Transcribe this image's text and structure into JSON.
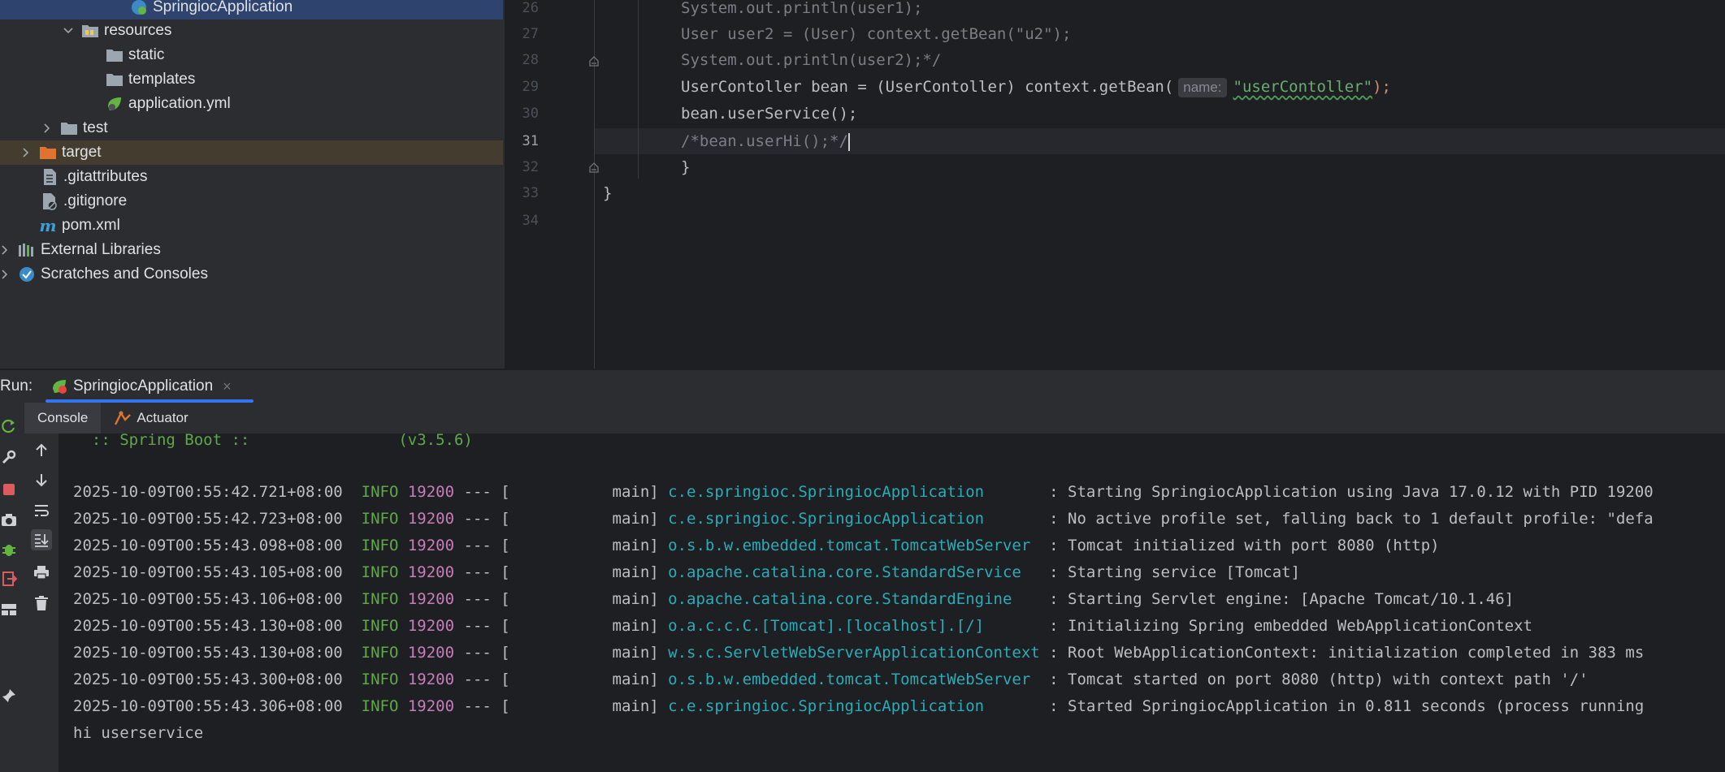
{
  "project_tree": {
    "items": [
      {
        "label": "SpringiocApplication",
        "icon": "spring-boot-class-icon",
        "expandable": false,
        "expanded": false
      },
      {
        "label": "resources",
        "icon": "resources-folder-icon",
        "expandable": true,
        "expanded": true
      },
      {
        "label": "static",
        "icon": "folder-icon",
        "expandable": false,
        "expanded": false
      },
      {
        "label": "templates",
        "icon": "folder-icon",
        "expandable": false,
        "expanded": false
      },
      {
        "label": "application.yml",
        "icon": "spring-config-icon",
        "expandable": false,
        "expanded": false
      },
      {
        "label": "test",
        "icon": "folder-icon",
        "expandable": true,
        "expanded": false
      },
      {
        "label": "target",
        "icon": "excluded-folder-icon",
        "expandable": true,
        "expanded": false
      },
      {
        "label": ".gitattributes",
        "icon": "file-icon",
        "expandable": false,
        "expanded": false
      },
      {
        "label": ".gitignore",
        "icon": "ignored-file-icon",
        "expandable": false,
        "expanded": false
      },
      {
        "label": "pom.xml",
        "icon": "maven-icon",
        "expandable": false,
        "expanded": false
      },
      {
        "label": "External Libraries",
        "icon": "libraries-icon",
        "expandable": true,
        "expanded": false
      },
      {
        "label": "Scratches and Consoles",
        "icon": "scratches-icon",
        "expandable": true,
        "expanded": false
      }
    ]
  },
  "editor": {
    "current_line": "31",
    "lines": [
      {
        "number": "26",
        "text": "System.out.println(user1);"
      },
      {
        "number": "27",
        "text": "User user2 = (User) context.getBean(\"u2\");"
      },
      {
        "number": "28",
        "text": "System.out.println(user2);*/"
      },
      {
        "number": "29",
        "text_before": "UserContoller bean = (UserContoller) context.getBean(",
        "hint": "name:",
        "string": "\"userContoller\"",
        "text_after": ");"
      },
      {
        "number": "30",
        "text": "bean.userService();"
      },
      {
        "number": "31",
        "text": "/*bean.userHi();*/"
      },
      {
        "number": "32",
        "text": "}"
      },
      {
        "number": "33",
        "text": "}"
      },
      {
        "number": "34",
        "text": ""
      }
    ]
  },
  "run_panel": {
    "label": "Run:",
    "tab_label": "SpringiocApplication",
    "subtabs": [
      "Console",
      "Actuator"
    ],
    "console": {
      "banner": "  :: Spring Boot ::                (v3.5.6)",
      "log_lines": [
        {
          "timestamp": "2025-10-09T00:55:42.721+08:00",
          "level": "INFO",
          "pid": "19200",
          "thread": "--- [           main]",
          "logger": "c.e.springioc.SpringiocApplication      ",
          "message": " : Starting SpringiocApplication using Java 17.0.12 with PID 19200"
        },
        {
          "timestamp": "2025-10-09T00:55:42.723+08:00",
          "level": "INFO",
          "pid": "19200",
          "thread": "--- [           main]",
          "logger": "c.e.springioc.SpringiocApplication      ",
          "message": " : No active profile set, falling back to 1 default profile: \"defa"
        },
        {
          "timestamp": "2025-10-09T00:55:43.098+08:00",
          "level": "INFO",
          "pid": "19200",
          "thread": "--- [           main]",
          "logger": "o.s.b.w.embedded.tomcat.TomcatWebServer ",
          "message": " : Tomcat initialized with port 8080 (http)"
        },
        {
          "timestamp": "2025-10-09T00:55:43.105+08:00",
          "level": "INFO",
          "pid": "19200",
          "thread": "--- [           main]",
          "logger": "o.apache.catalina.core.StandardService  ",
          "message": " : Starting service [Tomcat]"
        },
        {
          "timestamp": "2025-10-09T00:55:43.106+08:00",
          "level": "INFO",
          "pid": "19200",
          "thread": "--- [           main]",
          "logger": "o.apache.catalina.core.StandardEngine   ",
          "message": " : Starting Servlet engine: [Apache Tomcat/10.1.46]"
        },
        {
          "timestamp": "2025-10-09T00:55:43.130+08:00",
          "level": "INFO",
          "pid": "19200",
          "thread": "--- [           main]",
          "logger": "o.a.c.c.C.[Tomcat].[localhost].[/]      ",
          "message": " : Initializing Spring embedded WebApplicationContext"
        },
        {
          "timestamp": "2025-10-09T00:55:43.130+08:00",
          "level": "INFO",
          "pid": "19200",
          "thread": "--- [           main]",
          "logger": "w.s.c.ServletWebServerApplicationContext",
          "message": " : Root WebApplicationContext: initialization completed in 383 ms"
        },
        {
          "timestamp": "2025-10-09T00:55:43.300+08:00",
          "level": "INFO",
          "pid": "19200",
          "thread": "--- [           main]",
          "logger": "o.s.b.w.embedded.tomcat.TomcatWebServer ",
          "message": " : Tomcat started on port 8080 (http) with context path '/'"
        },
        {
          "timestamp": "2025-10-09T00:55:43.306+08:00",
          "level": "INFO",
          "pid": "19200",
          "thread": "--- [           main]",
          "logger": "c.e.springioc.SpringiocApplication      ",
          "message": " : Started SpringiocApplication in 0.811 seconds (process running"
        }
      ],
      "output": "hi userservice"
    }
  },
  "colors": {
    "selection": "#2e436e",
    "excluded": "#433c2f",
    "accent": "#3574f0",
    "string": "#6aab73",
    "logger": "#2aacb8",
    "pid": "#c77dbb",
    "info": "#5fa84a"
  }
}
